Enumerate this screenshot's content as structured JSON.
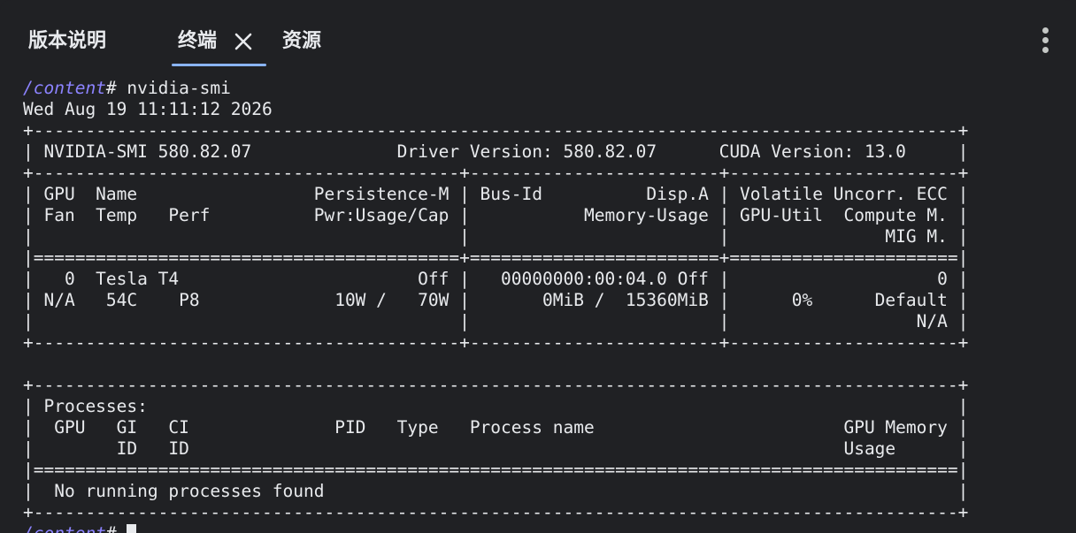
{
  "tabs": {
    "release_notes": "版本说明",
    "terminal": "终端",
    "resources": "资源"
  },
  "icons": {
    "close": "close-icon",
    "menu": "more-vert-icon"
  },
  "colors": {
    "background": "#202124",
    "text": "#e8eaed",
    "prompt_path": "#8c83ff",
    "active_tab_underline": "#8ab4f8"
  },
  "terminal": {
    "prompt_path": "/content",
    "prompt_symbol": "#",
    "command": " nvidia-smi",
    "lines": [
      "Wed Aug 19 11:11:12 2026",
      "+-----------------------------------------------------------------------------------------+",
      "| NVIDIA-SMI 580.82.07              Driver Version: 580.82.07      CUDA Version: 13.0     |",
      "+-----------------------------------------+------------------------+----------------------+",
      "| GPU  Name                 Persistence-M | Bus-Id          Disp.A | Volatile Uncorr. ECC |",
      "| Fan  Temp   Perf          Pwr:Usage/Cap |           Memory-Usage | GPU-Util  Compute M. |",
      "|                                         |                        |               MIG M. |",
      "|=========================================+========================+======================|",
      "|   0  Tesla T4                       Off |   00000000:00:04.0 Off |                    0 |",
      "| N/A   54C    P8             10W /   70W |       0MiB /  15360MiB |      0%      Default |",
      "|                                         |                        |                  N/A |",
      "+-----------------------------------------+------------------------+----------------------+",
      "",
      "+-----------------------------------------------------------------------------------------+",
      "| Processes:                                                                              |",
      "|  GPU   GI   CI              PID   Type   Process name                        GPU Memory |",
      "|        ID   ID                                                               Usage      |",
      "|=========================================================================================|",
      "|  No running processes found                                                             |",
      "+-----------------------------------------------------------------------------------------+"
    ],
    "final_prompt_path": "/content",
    "final_prompt_symbol": "#"
  }
}
